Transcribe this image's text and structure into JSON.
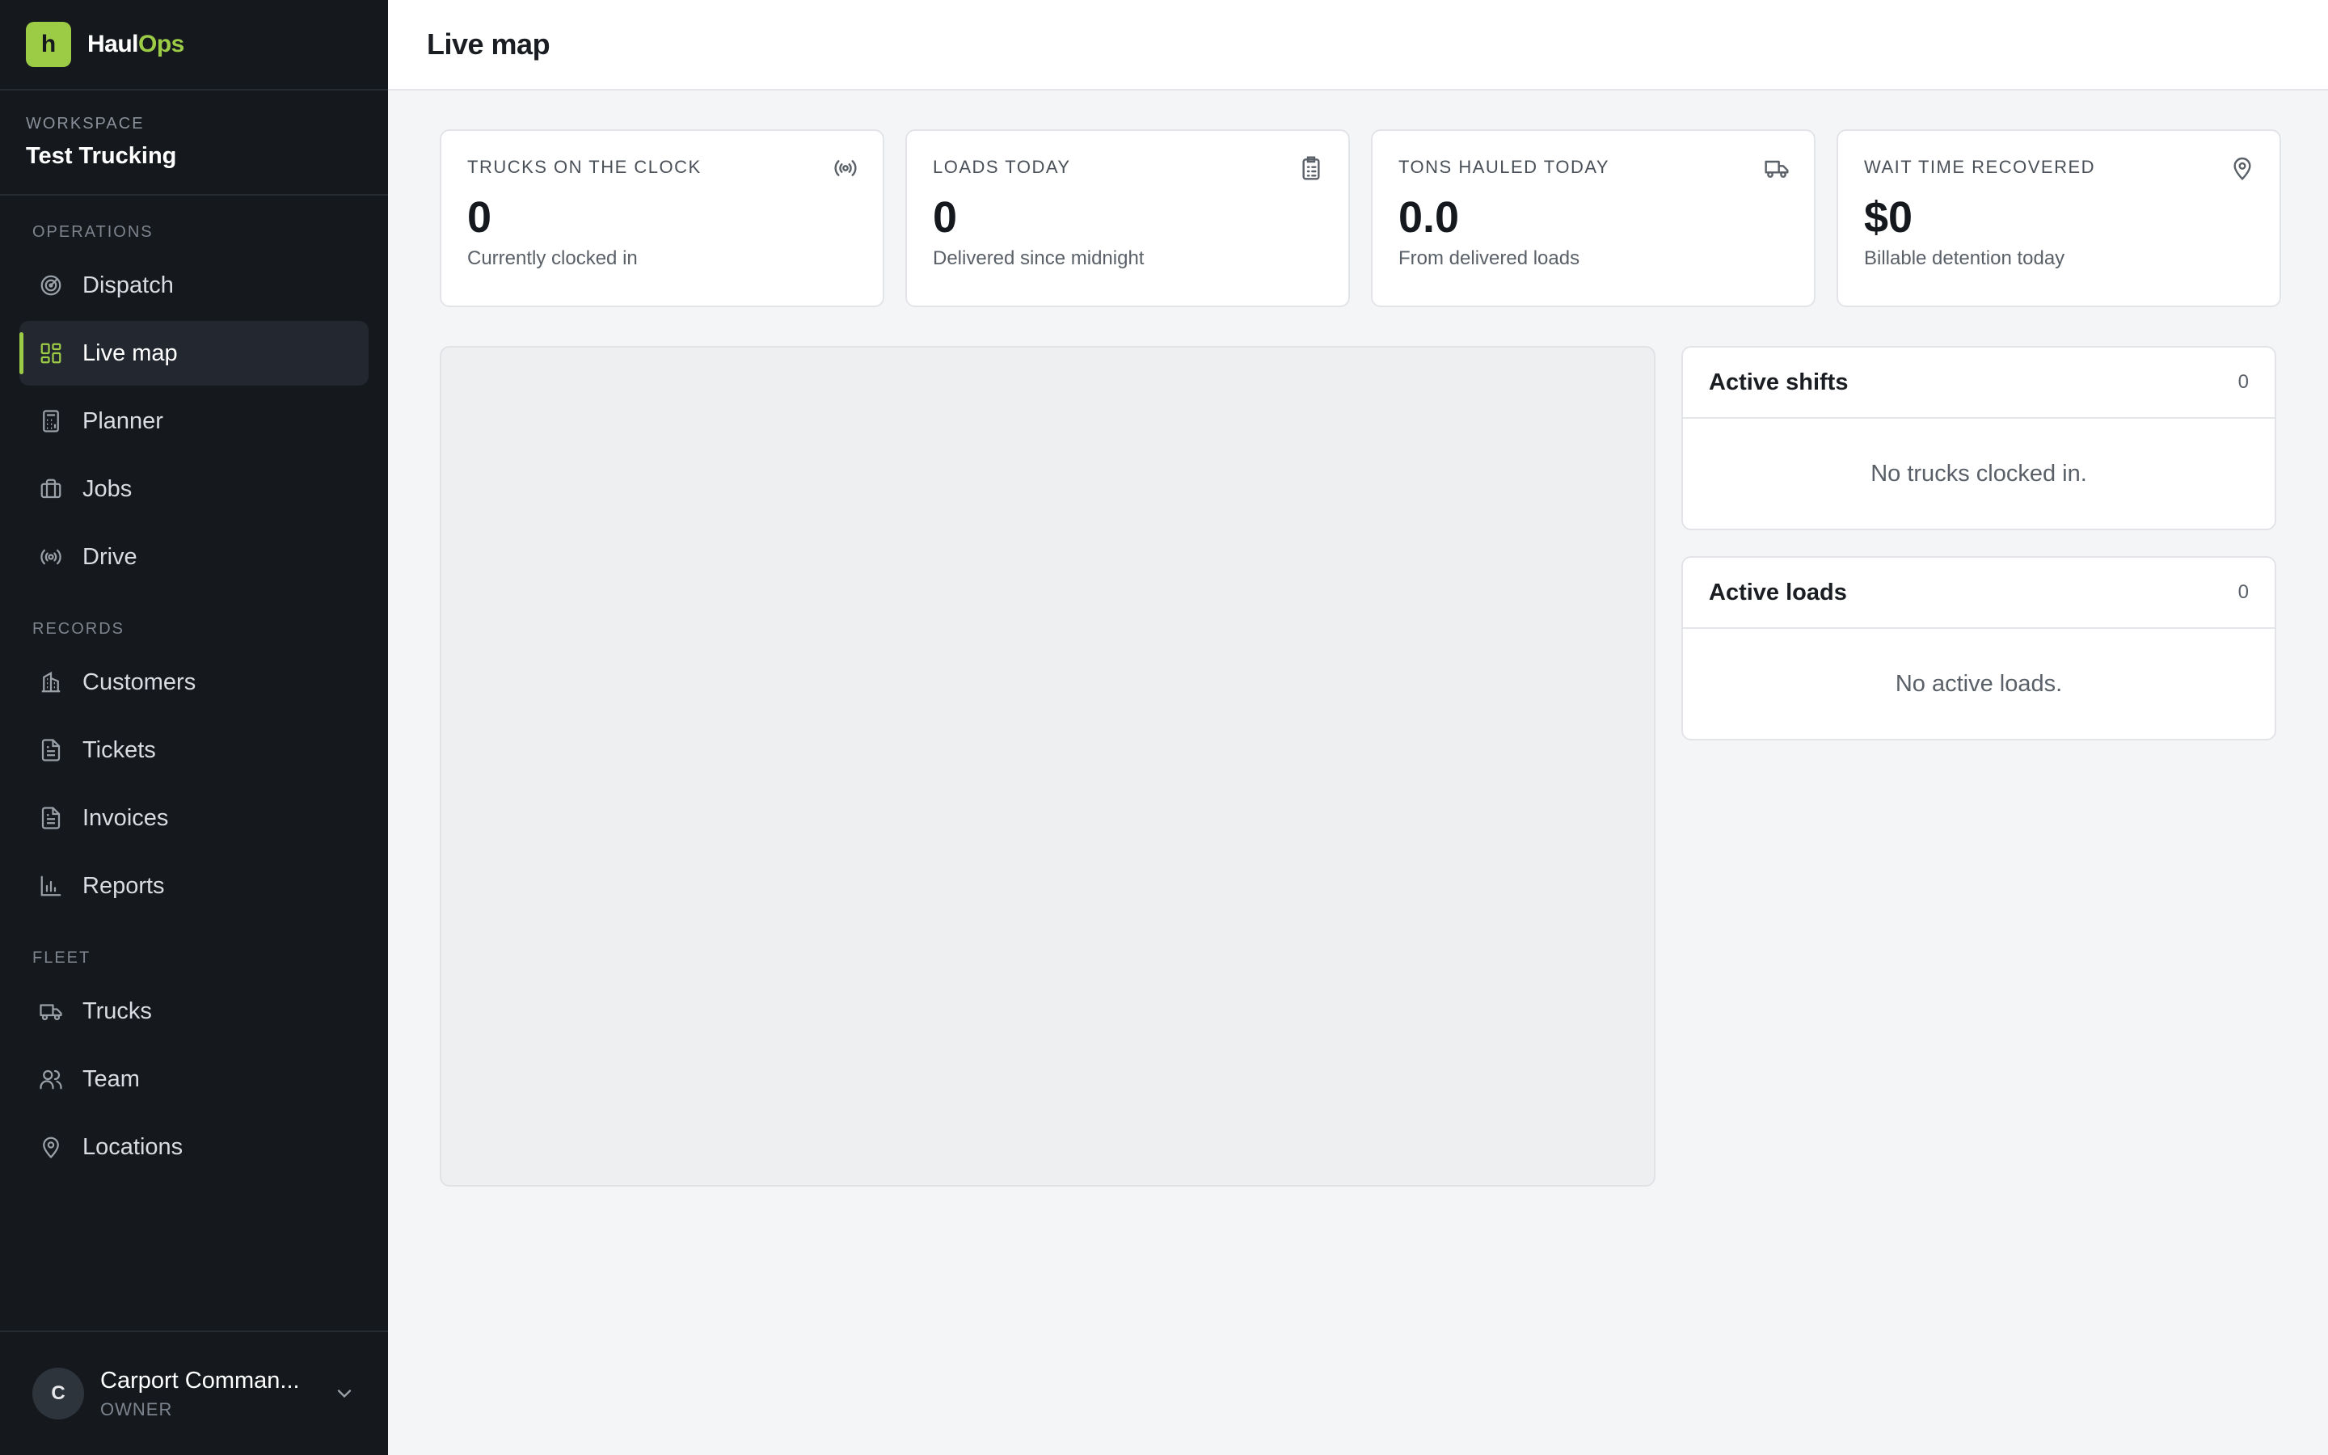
{
  "brand": {
    "logo_letter": "h",
    "name_part1": "Haul",
    "name_part2": "Ops",
    "accent": "#9ccc45"
  },
  "workspace": {
    "label": "WORKSPACE",
    "name": "Test Trucking"
  },
  "nav": {
    "sections": [
      {
        "title": "OPERATIONS",
        "items": [
          {
            "label": "Dispatch",
            "icon": "radar-icon"
          },
          {
            "label": "Live map",
            "icon": "dashboard-grid-icon",
            "active": true
          },
          {
            "label": "Planner",
            "icon": "calculator-icon"
          },
          {
            "label": "Jobs",
            "icon": "briefcase-icon"
          },
          {
            "label": "Drive",
            "icon": "broadcast-icon"
          }
        ]
      },
      {
        "title": "RECORDS",
        "items": [
          {
            "label": "Customers",
            "icon": "building-icon"
          },
          {
            "label": "Tickets",
            "icon": "file-text-icon"
          },
          {
            "label": "Invoices",
            "icon": "file-text-icon"
          },
          {
            "label": "Reports",
            "icon": "bar-chart-icon"
          }
        ]
      },
      {
        "title": "FLEET",
        "items": [
          {
            "label": "Trucks",
            "icon": "truck-icon"
          },
          {
            "label": "Team",
            "icon": "users-icon"
          },
          {
            "label": "Locations",
            "icon": "map-pin-icon"
          }
        ]
      }
    ]
  },
  "user": {
    "initial": "C",
    "name": "Carport Comman...",
    "role": "OWNER"
  },
  "header": {
    "title": "Live map"
  },
  "stats": [
    {
      "label": "TRUCKS ON THE CLOCK",
      "value": "0",
      "sub": "Currently clocked in",
      "icon": "broadcast-icon"
    },
    {
      "label": "LOADS TODAY",
      "value": "0",
      "sub": "Delivered since midnight",
      "icon": "clipboard-icon"
    },
    {
      "label": "TONS HAULED TODAY",
      "value": "0.0",
      "sub": "From delivered loads",
      "icon": "truck-icon"
    },
    {
      "label": "WAIT TIME RECOVERED",
      "value": "$0",
      "sub": "Billable detention today",
      "icon": "map-pin-icon"
    }
  ],
  "panels": {
    "shifts": {
      "title": "Active shifts",
      "count": "0",
      "empty": "No trucks clocked in."
    },
    "loads": {
      "title": "Active loads",
      "count": "0",
      "empty": "No active loads."
    }
  }
}
